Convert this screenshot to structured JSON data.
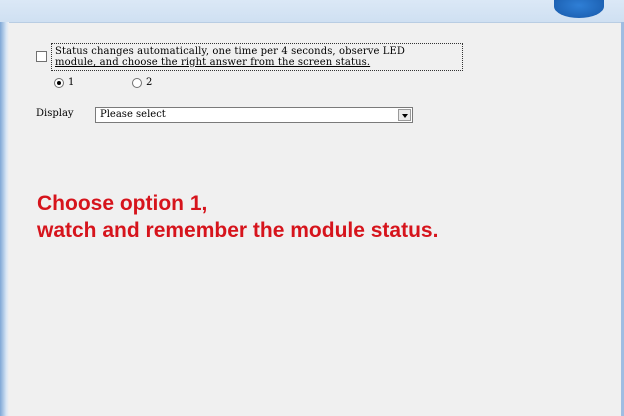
{
  "colors": {
    "accent_red": "#d6141c",
    "window_bg": "#f0f0f0",
    "frame_blue": "#cfe0f2"
  },
  "status": {
    "checkbox_checked": false,
    "text_line1": "Status changes automatically, one time per 4 seconds, observe LED",
    "text_line2": "module, and choose the right answer from the screen status."
  },
  "options": {
    "selected": "1",
    "items": [
      {
        "label": "1",
        "checked": true
      },
      {
        "label": "2",
        "checked": false
      }
    ]
  },
  "display": {
    "label": "Display",
    "select_value": "Please select",
    "arrow_icon": "chevron-down-icon"
  },
  "instruction": {
    "line1": "Choose option 1,",
    "line2": "watch and remember the module status."
  }
}
